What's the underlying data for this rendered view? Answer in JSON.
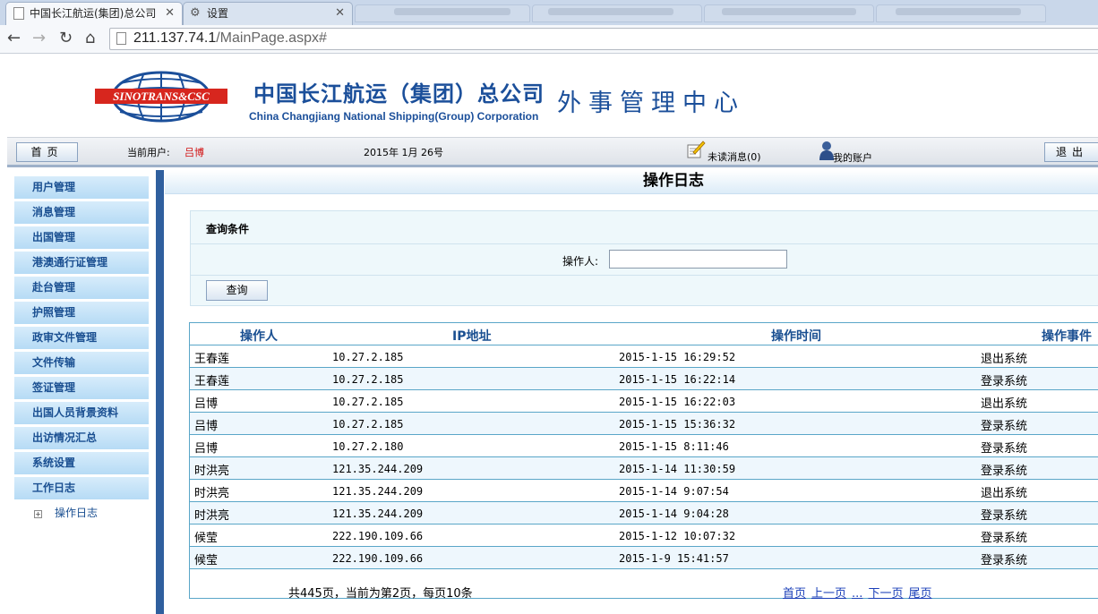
{
  "browser": {
    "active_tab": "中国长江航运(集团)总公司",
    "settings_tab": "设置",
    "url_host": "211.137.74.1",
    "url_path": "/MainPage.aspx#"
  },
  "header": {
    "logo_text": "SINOTRANS&CSC",
    "company_cn": "中国长江航运（集团）总公司",
    "company_en": "China Changjiang National Shipping(Group) Corporation",
    "center": "外事管理中心"
  },
  "statusbar": {
    "home": "首页",
    "current_user_label": "当前用户:",
    "current_user": "吕博",
    "date": "2015年 1月 26号",
    "messages": "未读消息(0)",
    "account": "我的账户",
    "logout": "退出"
  },
  "sidebar": {
    "items": [
      "用户管理",
      "消息管理",
      "出国管理",
      "港澳通行证管理",
      "赴台管理",
      "护照管理",
      "政审文件管理",
      "文件传输",
      "签证管理",
      "出国人员背景资料",
      "出访情况汇总",
      "系统设置",
      "工作日志"
    ],
    "sub_item": "操作日志"
  },
  "main": {
    "title": "操作日志",
    "query_title": "查询条件",
    "operator_label": "操作人:",
    "operator_value": "",
    "search_button": "查询"
  },
  "table": {
    "headers": [
      "操作人",
      "IP地址",
      "操作时间",
      "操作事件"
    ],
    "rows": [
      [
        "王春莲",
        "10.27.2.185",
        "2015-1-15 16:29:52",
        "退出系统"
      ],
      [
        "王春莲",
        "10.27.2.185",
        "2015-1-15 16:22:14",
        "登录系统"
      ],
      [
        "吕博",
        "10.27.2.185",
        "2015-1-15 16:22:03",
        "退出系统"
      ],
      [
        "吕博",
        "10.27.2.185",
        "2015-1-15 15:36:32",
        "登录系统"
      ],
      [
        "吕博",
        "10.27.2.180",
        "2015-1-15 8:11:46",
        "登录系统"
      ],
      [
        "时洪亮",
        "121.35.244.209",
        "2015-1-14 11:30:59",
        "登录系统"
      ],
      [
        "时洪亮",
        "121.35.244.209",
        "2015-1-14 9:07:54",
        "退出系统"
      ],
      [
        "时洪亮",
        "121.35.244.209",
        "2015-1-14 9:04:28",
        "登录系统"
      ],
      [
        "候莹",
        "222.190.109.66",
        "2015-1-12 10:07:32",
        "登录系统"
      ],
      [
        "候莹",
        "222.190.109.66",
        "2015-1-9 15:41:57",
        "登录系统"
      ]
    ],
    "pager_info": "共445页，当前为第2页，每页10条",
    "pager_links": [
      "首页",
      "上一页",
      "...",
      "下一页",
      "尾页"
    ]
  }
}
